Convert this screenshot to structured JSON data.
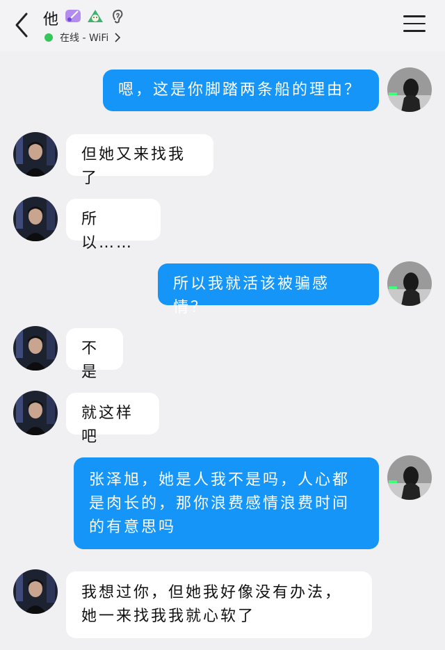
{
  "header": {
    "contact_name": "他",
    "status_text": "在线 - WiFi",
    "badge_icons": [
      "guitar-badge-icon",
      "rice-dumpling-badge-icon",
      "ear-badge-icon"
    ]
  },
  "colors": {
    "outgoing_bubble": "#1495f7",
    "incoming_bubble": "#ffffff",
    "background": "#f0f0f2",
    "online_dot": "#35c759"
  },
  "messages": [
    {
      "sender": "me",
      "text": "嗯，这是你脚踏两条船的理由？"
    },
    {
      "sender": "them",
      "text": "但她又来找我了"
    },
    {
      "sender": "them",
      "text": "所以……"
    },
    {
      "sender": "me",
      "text": "所以我就活该被骗感情？"
    },
    {
      "sender": "them",
      "text": "不是"
    },
    {
      "sender": "them",
      "text": "就这样吧"
    },
    {
      "sender": "me",
      "text": "张泽旭，她是人我不是吗，人心都是肉长的，那你浪费感情浪费时间的有意思吗"
    },
    {
      "sender": "them",
      "text": "我想过你，但她我好像没有办法，她一来找我我就心软了"
    }
  ]
}
